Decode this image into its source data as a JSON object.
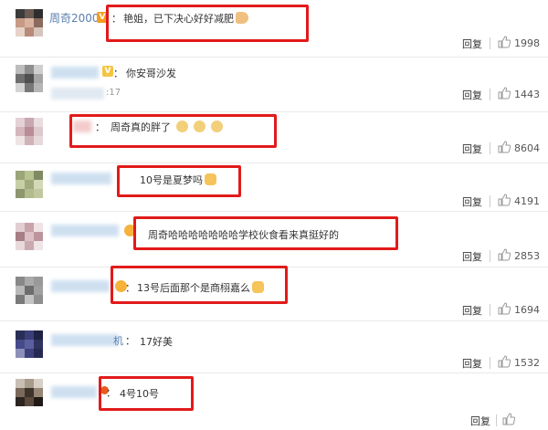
{
  "reply_label": "回复",
  "comments": [
    {
      "user": "周奇2000",
      "text": "艳姐，已下决心好好减肥",
      "time": "",
      "likes": "1998"
    },
    {
      "user": "",
      "text": "你安哥沙发",
      "time": ":17",
      "likes": "1443"
    },
    {
      "user": "",
      "text": "周奇真的胖了",
      "time": "",
      "likes": "8604"
    },
    {
      "user": "",
      "text": "10号是夏梦吗",
      "time": "",
      "likes": "4191"
    },
    {
      "user": "",
      "text": "周奇哈哈哈哈哈哈哈学校伙食看来真挺好的",
      "time": "",
      "likes": "2853"
    },
    {
      "user": "",
      "text": "13号后面那个是商栩嘉么",
      "time": "",
      "likes": "1694"
    },
    {
      "user": "",
      "text": "17好美",
      "time": "",
      "likes": "1532"
    },
    {
      "user": "",
      "text": "4号10号",
      "time": "",
      "likes": ""
    }
  ],
  "colors": {
    "highlight": "#e21a1a",
    "link": "#5b7fb0",
    "vip": "#f59d1d"
  }
}
